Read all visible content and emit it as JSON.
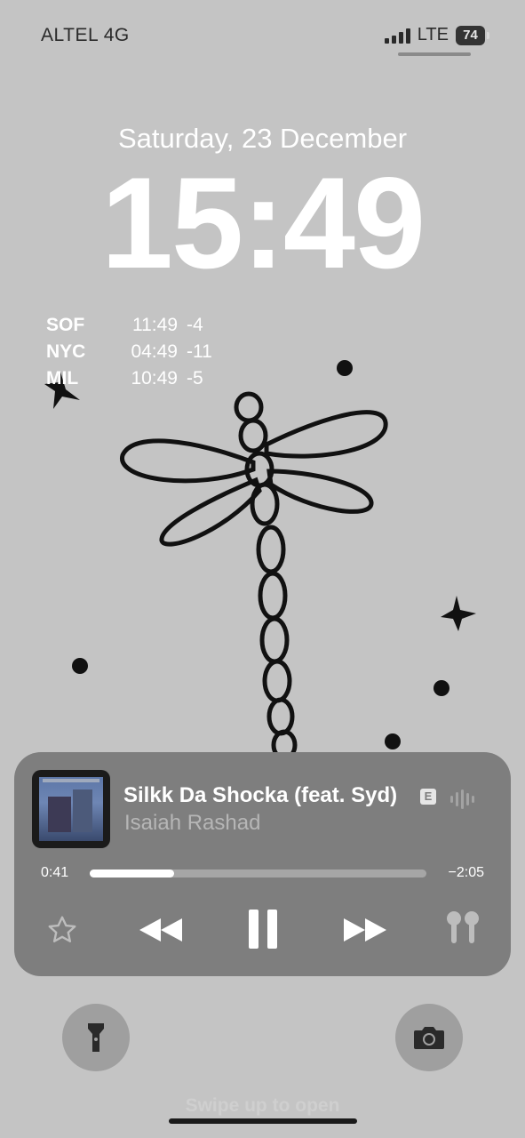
{
  "status_bar": {
    "carrier": "ALTEL 4G",
    "network": "LTE",
    "battery": "74",
    "signal_icon": "cellular-signal-icon",
    "battery_icon": "battery-icon"
  },
  "lock_screen": {
    "date": "Saturday, 23 December",
    "time": "15:49"
  },
  "world_clock": [
    {
      "city": "SOF",
      "time": "11:49",
      "offset": "-4"
    },
    {
      "city": "NYC",
      "time": "04:49",
      "offset": "-11"
    },
    {
      "city": "MIL",
      "time": "10:49",
      "offset": "-5"
    }
  ],
  "now_playing": {
    "title": "Silkk Da Shocka (feat. Syd)",
    "explicit_badge": "E",
    "artist": "Isaiah Rashad",
    "elapsed": "0:41",
    "remaining": "−2:05",
    "progress": 0.25,
    "icons": {
      "favorite": "star-icon",
      "previous": "rewind-icon",
      "play_pause": "pause-icon",
      "next": "fast-forward-icon",
      "output": "airpods-icon",
      "waveform": "waveform-icon"
    }
  },
  "bottom": {
    "swipe_hint": "Swipe up to open",
    "left_icon": "flashlight-icon",
    "right_icon": "camera-icon"
  },
  "colors": {
    "background": "#c4c4c4",
    "player_bg": "#7e7e7e",
    "text_primary": "#ffffff"
  }
}
